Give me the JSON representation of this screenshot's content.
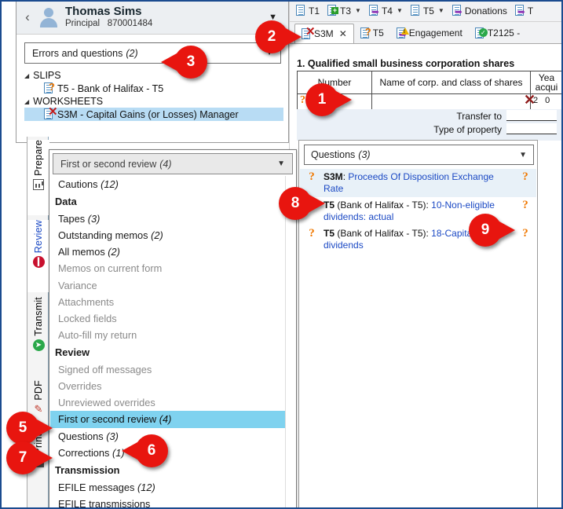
{
  "client": {
    "back_icon": "chevron-left-icon",
    "avatar_icon": "person-avatar-icon",
    "name": "Thomas Sims",
    "role": "Principal",
    "id": "870001484",
    "caret_icon": "chevron-down-icon"
  },
  "diagnostics_filter": {
    "label": "Errors and questions",
    "count": "(2)",
    "caret_icon": "chevron-down-icon"
  },
  "tree": {
    "groups": [
      {
        "label": "SLIPS",
        "triangle_icon": "triangle-down-icon",
        "items": [
          {
            "label": "T5 - Bank of Halifax - T5",
            "icon": "document-question-icon",
            "selected": false
          }
        ]
      },
      {
        "label": "WORKSHEETS",
        "triangle_icon": "triangle-down-icon",
        "items": [
          {
            "label": "S3M - Capital Gains (or Losses) Manager",
            "icon": "document-error-icon",
            "selected": true
          }
        ]
      }
    ]
  },
  "vertical_tabs": [
    {
      "label": "Prepare",
      "icon": "bar-chart-icon",
      "active": true
    },
    {
      "label": "Review",
      "icon": "stop-sign-icon",
      "active": true
    },
    {
      "label": "Transmit",
      "icon": "send-icon",
      "active": false
    },
    {
      "label": "PDF",
      "icon": "pdf-icon",
      "active": false
    },
    {
      "label": "Print",
      "icon": "printer-icon",
      "active": false
    }
  ],
  "dropdown": {
    "selected_label": "First or second review",
    "selected_count": "(4)",
    "caret_icon": "chevron-down-icon",
    "items": [
      {
        "label": "Cautions",
        "count": "(12)",
        "type": "item",
        "state": "normal"
      },
      {
        "label": "Data",
        "count": "",
        "type": "group",
        "state": "normal"
      },
      {
        "label": "Tapes",
        "count": "(3)",
        "type": "item",
        "state": "normal"
      },
      {
        "label": "Outstanding memos",
        "count": "(2)",
        "type": "item",
        "state": "normal"
      },
      {
        "label": "All memos",
        "count": "(2)",
        "type": "item",
        "state": "normal"
      },
      {
        "label": "Memos on current form",
        "count": "",
        "type": "item",
        "state": "dim"
      },
      {
        "label": "Variance",
        "count": "",
        "type": "item",
        "state": "dim"
      },
      {
        "label": "Attachments",
        "count": "",
        "type": "item",
        "state": "dim"
      },
      {
        "label": "Locked fields",
        "count": "",
        "type": "item",
        "state": "dim"
      },
      {
        "label": "Auto-fill my return",
        "count": "",
        "type": "item",
        "state": "dim"
      },
      {
        "label": "Review",
        "count": "",
        "type": "group",
        "state": "normal"
      },
      {
        "label": "Signed off messages",
        "count": "",
        "type": "item",
        "state": "dim"
      },
      {
        "label": "Overrides",
        "count": "",
        "type": "item",
        "state": "dim"
      },
      {
        "label": "Unreviewed overrides",
        "count": "",
        "type": "item",
        "state": "dim"
      },
      {
        "label": "First or second review",
        "count": "(4)",
        "type": "item",
        "state": "selected"
      },
      {
        "label": "Questions",
        "count": "(3)",
        "type": "item",
        "state": "normal"
      },
      {
        "label": "Corrections",
        "count": "(1)",
        "type": "item",
        "state": "normal"
      },
      {
        "label": "Transmission",
        "count": "",
        "type": "group",
        "state": "normal"
      },
      {
        "label": "EFILE messages",
        "count": "(12)",
        "type": "item",
        "state": "normal"
      },
      {
        "label": "EFILE transmissions",
        "count": "",
        "type": "item",
        "state": "normal"
      }
    ]
  },
  "form_toolbar": [
    {
      "label": "T1",
      "icon": "document-icon",
      "has_caret": false
    },
    {
      "label": "T3",
      "icon": "document-add-icon",
      "has_caret": true
    },
    {
      "label": "T4",
      "icon": "document-arrow-icon",
      "has_caret": true
    },
    {
      "label": "T5",
      "icon": "document-icon",
      "has_caret": true
    },
    {
      "label": "Donations",
      "icon": "document-arrow-icon",
      "has_caret": false
    },
    {
      "label": "T",
      "icon": "document-arrow-icon",
      "has_caret": false
    }
  ],
  "form_tabs": [
    {
      "label": "S3M",
      "icon": "document-error-icon",
      "active": true,
      "closable": true,
      "close_icon": "close-icon"
    },
    {
      "label": "T5",
      "icon": "document-question-icon",
      "active": false,
      "closable": false
    },
    {
      "label": "Engagement",
      "icon": "document-warning-icon",
      "active": false,
      "closable": false
    },
    {
      "label": "T2125 -",
      "icon": "document-check-icon",
      "active": false,
      "closable": false
    }
  ],
  "form": {
    "section_title": "1. Qualified small business corporation shares",
    "columns": [
      {
        "label": "Number"
      },
      {
        "label": "Name of corp. and class of shares"
      },
      {
        "label": "Yea\nacqui"
      }
    ],
    "row": {
      "number_marker_icon": "question-mark-icon",
      "name_value": "",
      "error_marker_icon": "red-x-icon",
      "year_value": "2  0"
    },
    "transfer_label": "Transfer to",
    "type_label": "Type of property"
  },
  "questions_panel": {
    "filter_label": "Questions",
    "filter_count": "(3)",
    "caret_icon": "chevron-down-icon",
    "rows": [
      {
        "left_icon": "question-mark-icon",
        "right_icon": "question-mark-icon",
        "form": "S3M",
        "separator": ": ",
        "detail": "Proceeds Of Disposition Exchange Rate",
        "selected": true
      },
      {
        "left_icon": "question-mark-icon",
        "right_icon": "question-mark-icon",
        "form": "T5",
        "separator": " (Bank of Halifax - T5): ",
        "detail": "10-Non-eligible dividends: actual",
        "selected": false
      },
      {
        "left_icon": "question-mark-icon",
        "right_icon": "question-mark-icon",
        "form": "T5",
        "separator": " (Bank of Halifax - T5): ",
        "detail": "18-Capital dividends",
        "selected": false
      }
    ]
  },
  "callouts": [
    {
      "number": "1"
    },
    {
      "number": "2"
    },
    {
      "number": "3"
    },
    {
      "number": "5"
    },
    {
      "number": "6"
    },
    {
      "number": "7"
    },
    {
      "number": "8"
    },
    {
      "number": "9"
    }
  ],
  "colors": {
    "accent_red": "#e8150f",
    "selection_blue": "#b8dcf4",
    "dropdown_selection": "#7fd2ef",
    "link_blue": "#1b49c4",
    "question_orange": "#f07800",
    "error_red": "#8e1b1b",
    "frame_blue": "#1b4b8f"
  }
}
